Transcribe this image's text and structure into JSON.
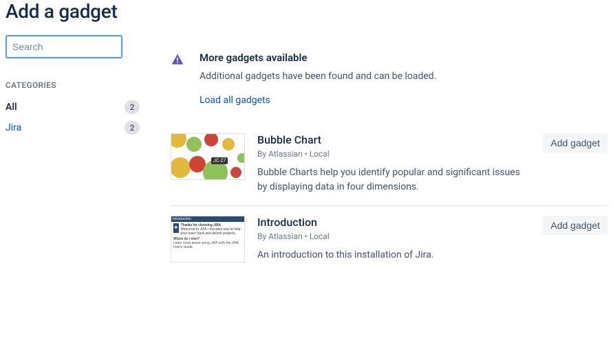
{
  "header": {
    "title": "Add a gadget"
  },
  "search": {
    "placeholder": "Search"
  },
  "categories": {
    "heading": "CATEGORIES",
    "items": [
      {
        "label": "All",
        "count": "2"
      },
      {
        "label": "Jira",
        "count": "2"
      }
    ]
  },
  "notice": {
    "title": "More gadgets available",
    "text": "Additional gadgets have been found and can be loaded.",
    "link": "Load all gadgets"
  },
  "gadgets": [
    {
      "title": "Bubble Chart",
      "byline": "By Atlassian • Local",
      "description": "Bubble Charts help you identify popular and significant issues by displaying data in four dimensions.",
      "add_label": "Add gadget",
      "thumb_tag": "JC-27"
    },
    {
      "title": "Introduction",
      "byline": "By Atlassian • Local",
      "description": "An introduction to this installation of Jira.",
      "add_label": "Add gadget"
    }
  ]
}
